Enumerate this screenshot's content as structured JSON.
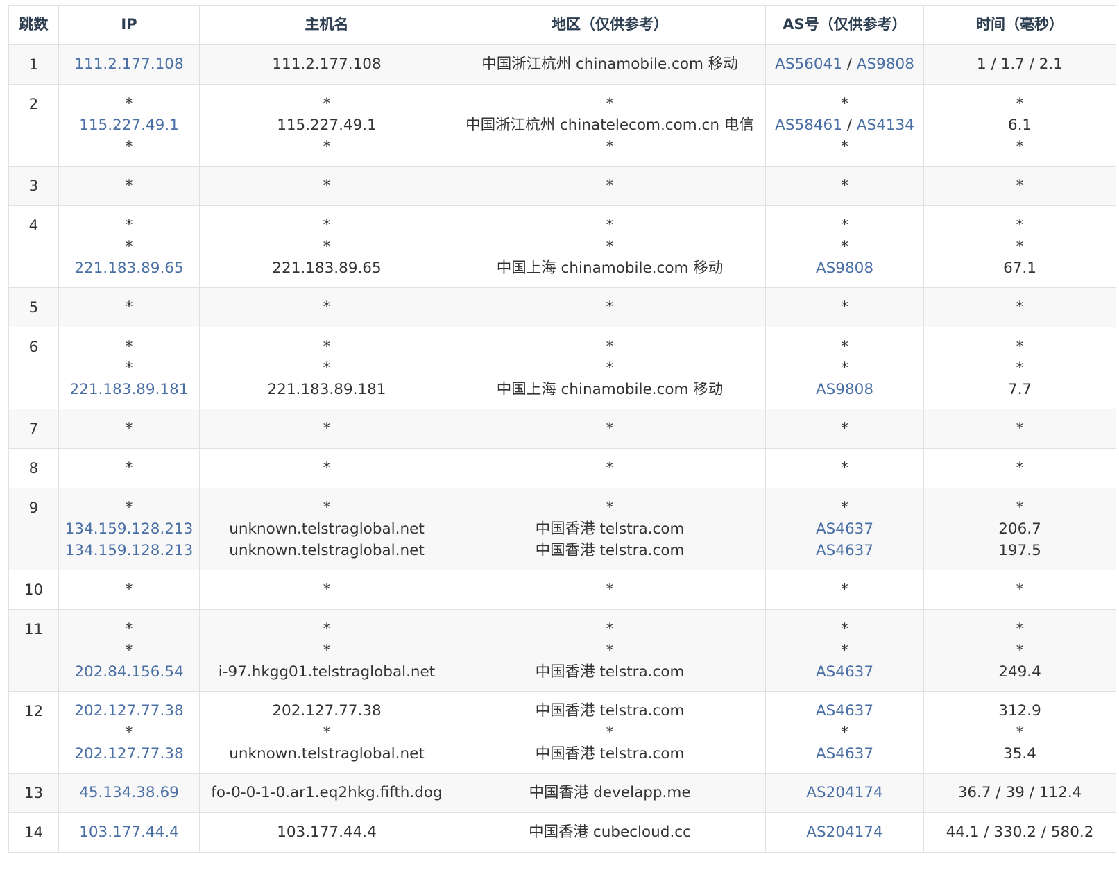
{
  "headers": {
    "hop": "跳数",
    "ip": "IP",
    "host": "主机名",
    "region": "地区（仅供参考）",
    "asn": "AS号（仅供参考）",
    "time": "时间（毫秒）"
  },
  "colors": {
    "link": "#4a6fa5",
    "text": "#333333",
    "border": "#dfe2e5",
    "stripe": "#f8f8f8"
  },
  "rows": [
    {
      "hop": "1",
      "ip": [
        "111.2.177.108"
      ],
      "host": [
        "111.2.177.108"
      ],
      "region": [
        "中国浙江杭州 chinamobile.com 移动"
      ],
      "asn": [
        [
          "AS56041",
          "AS9808"
        ]
      ],
      "time": [
        "1 / 1.7 / 2.1"
      ]
    },
    {
      "hop": "2",
      "ip": [
        "*",
        "115.227.49.1",
        "*"
      ],
      "host": [
        "*",
        "115.227.49.1",
        "*"
      ],
      "region": [
        "*",
        "中国浙江杭州 chinatelecom.com.cn 电信",
        "*"
      ],
      "asn": [
        [
          "*"
        ],
        [
          "AS58461",
          "AS4134"
        ],
        [
          "*"
        ]
      ],
      "time": [
        "*",
        "6.1",
        "*"
      ]
    },
    {
      "hop": "3",
      "ip": [
        "*"
      ],
      "host": [
        "*"
      ],
      "region": [
        "*"
      ],
      "asn": [
        [
          "*"
        ]
      ],
      "time": [
        "*"
      ]
    },
    {
      "hop": "4",
      "ip": [
        "*",
        "*",
        "221.183.89.65"
      ],
      "host": [
        "*",
        "*",
        "221.183.89.65"
      ],
      "region": [
        "*",
        "*",
        "中国上海 chinamobile.com 移动"
      ],
      "asn": [
        [
          "*"
        ],
        [
          "*"
        ],
        [
          "AS9808"
        ]
      ],
      "time": [
        "*",
        "*",
        "67.1"
      ]
    },
    {
      "hop": "5",
      "ip": [
        "*"
      ],
      "host": [
        "*"
      ],
      "region": [
        "*"
      ],
      "asn": [
        [
          "*"
        ]
      ],
      "time": [
        "*"
      ]
    },
    {
      "hop": "6",
      "ip": [
        "*",
        "*",
        "221.183.89.181"
      ],
      "host": [
        "*",
        "*",
        "221.183.89.181"
      ],
      "region": [
        "*",
        "*",
        "中国上海 chinamobile.com 移动"
      ],
      "asn": [
        [
          "*"
        ],
        [
          "*"
        ],
        [
          "AS9808"
        ]
      ],
      "time": [
        "*",
        "*",
        "7.7"
      ]
    },
    {
      "hop": "7",
      "ip": [
        "*"
      ],
      "host": [
        "*"
      ],
      "region": [
        "*"
      ],
      "asn": [
        [
          "*"
        ]
      ],
      "time": [
        "*"
      ]
    },
    {
      "hop": "8",
      "ip": [
        "*"
      ],
      "host": [
        "*"
      ],
      "region": [
        "*"
      ],
      "asn": [
        [
          "*"
        ]
      ],
      "time": [
        "*"
      ]
    },
    {
      "hop": "9",
      "ip": [
        "*",
        "134.159.128.213",
        "134.159.128.213"
      ],
      "host": [
        "*",
        "unknown.telstraglobal.net",
        "unknown.telstraglobal.net"
      ],
      "region": [
        "*",
        "中国香港 telstra.com",
        "中国香港 telstra.com"
      ],
      "asn": [
        [
          "*"
        ],
        [
          "AS4637"
        ],
        [
          "AS4637"
        ]
      ],
      "time": [
        "*",
        "206.7",
        "197.5"
      ]
    },
    {
      "hop": "10",
      "ip": [
        "*"
      ],
      "host": [
        "*"
      ],
      "region": [
        "*"
      ],
      "asn": [
        [
          "*"
        ]
      ],
      "time": [
        "*"
      ]
    },
    {
      "hop": "11",
      "ip": [
        "*",
        "*",
        "202.84.156.54"
      ],
      "host": [
        "*",
        "*",
        "i-97.hkgg01.telstraglobal.net"
      ],
      "region": [
        "*",
        "*",
        "中国香港 telstra.com"
      ],
      "asn": [
        [
          "*"
        ],
        [
          "*"
        ],
        [
          "AS4637"
        ]
      ],
      "time": [
        "*",
        "*",
        "249.4"
      ]
    },
    {
      "hop": "12",
      "ip": [
        "202.127.77.38",
        "*",
        "202.127.77.38"
      ],
      "host": [
        "202.127.77.38",
        "*",
        "unknown.telstraglobal.net"
      ],
      "region": [
        "中国香港 telstra.com",
        "*",
        "中国香港 telstra.com"
      ],
      "asn": [
        [
          "AS4637"
        ],
        [
          "*"
        ],
        [
          "AS4637"
        ]
      ],
      "time": [
        "312.9",
        "*",
        "35.4"
      ]
    },
    {
      "hop": "13",
      "ip": [
        "45.134.38.69"
      ],
      "host": [
        "fo-0-0-1-0.ar1.eq2hkg.fifth.dog"
      ],
      "region": [
        "中国香港 develapp.me"
      ],
      "asn": [
        [
          "AS204174"
        ]
      ],
      "time": [
        "36.7 / 39 / 112.4"
      ]
    },
    {
      "hop": "14",
      "ip": [
        "103.177.44.4"
      ],
      "host": [
        "103.177.44.4"
      ],
      "region": [
        "中国香港 cubecloud.cc"
      ],
      "asn": [
        [
          "AS204174"
        ]
      ],
      "time": [
        "44.1 / 330.2 / 580.2"
      ]
    }
  ]
}
